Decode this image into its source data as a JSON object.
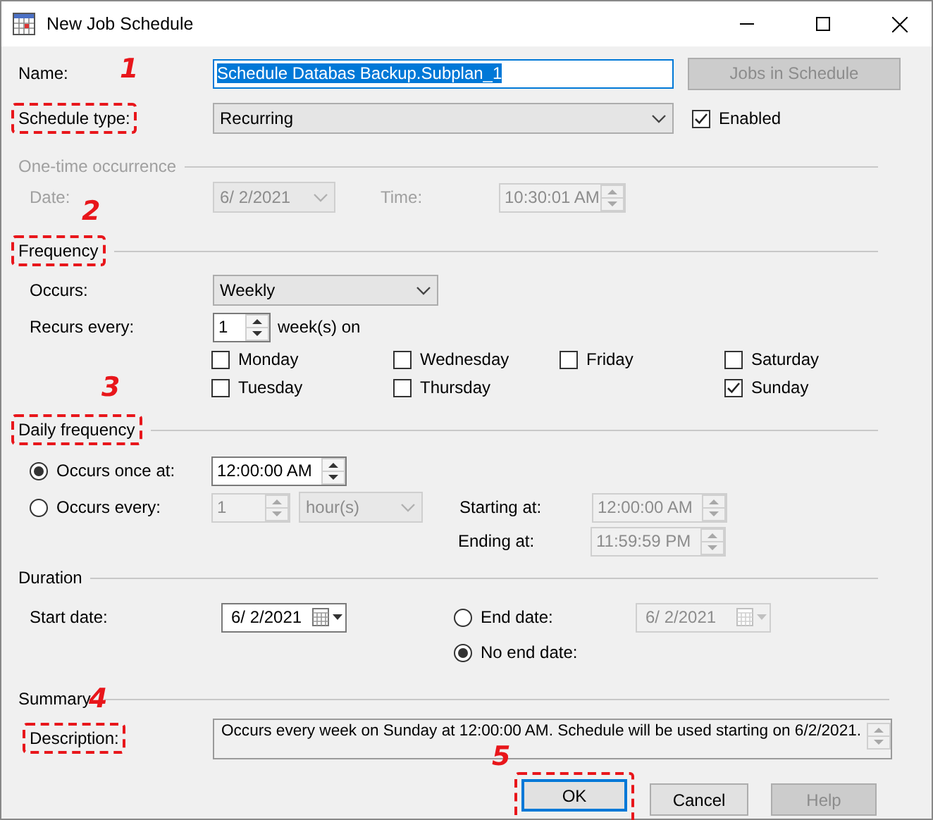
{
  "window": {
    "title": "New Job Schedule"
  },
  "name": {
    "label": "Name:",
    "value": "Schedule Databas Backup.Subplan_1",
    "selected": true,
    "annotation": "1"
  },
  "jobs_button": {
    "label": "Jobs in Schedule",
    "disabled": true
  },
  "schedule_type": {
    "label": "Schedule type:",
    "value": "Recurring",
    "highlighted": true
  },
  "enabled": {
    "label": "Enabled",
    "checked": true
  },
  "one_time": {
    "title": "One-time occurrence",
    "disabled": true,
    "date_label": "Date:",
    "date": "6/  2/2021",
    "time_label": "Time:",
    "time": "10:30:01 AM"
  },
  "frequency": {
    "title": "Frequency",
    "highlighted": true,
    "annotation": "2",
    "occurs_label": "Occurs:",
    "occurs": "Weekly",
    "recurs_label": "Recurs every:",
    "recurs": "1",
    "unit": "week(s) on",
    "day_rows": [
      [
        {
          "label": "Monday",
          "checked": false
        },
        {
          "label": "Wednesday",
          "checked": false
        },
        {
          "label": "Friday",
          "checked": false
        },
        {
          "label": "Saturday",
          "checked": false
        }
      ],
      [
        {
          "label": "Tuesday",
          "checked": false
        },
        {
          "label": "Thursday",
          "checked": false
        },
        {
          "label": "Sunday",
          "checked": true
        }
      ]
    ]
  },
  "daily": {
    "title": "Daily frequency",
    "highlighted": true,
    "annotation": "3",
    "once": {
      "label": "Occurs once at:",
      "selected": true,
      "time": "12:00:00 AM"
    },
    "every": {
      "label": "Occurs every:",
      "selected": false,
      "disabled": true,
      "value": "1",
      "unit": "hour(s)"
    },
    "start_label": "Starting at:",
    "start": "12:00:00 AM",
    "end_label": "Ending at:",
    "end": "11:59:59 PM"
  },
  "duration": {
    "title": "Duration",
    "start_label": "Start date:",
    "start": "6/  2/2021",
    "end": {
      "label": "End date:",
      "selected": false,
      "date": "6/  2/2021"
    },
    "no_end": {
      "label": "No end date:",
      "selected": true
    }
  },
  "summary": {
    "title": "Summary",
    "annotation": "4",
    "description_label": "Description:",
    "highlighted": true,
    "description": "Occurs every week on Sunday at 12:00:00 AM. Schedule will be used starting on 6/2/2021."
  },
  "buttons": [
    {
      "label": "OK",
      "default": true,
      "disabled": false,
      "highlighted": true,
      "annotation": "5"
    },
    {
      "label": "Cancel",
      "default": false,
      "disabled": false,
      "highlighted": false
    },
    {
      "label": "Help",
      "default": false,
      "disabled": true,
      "highlighted": false
    }
  ]
}
